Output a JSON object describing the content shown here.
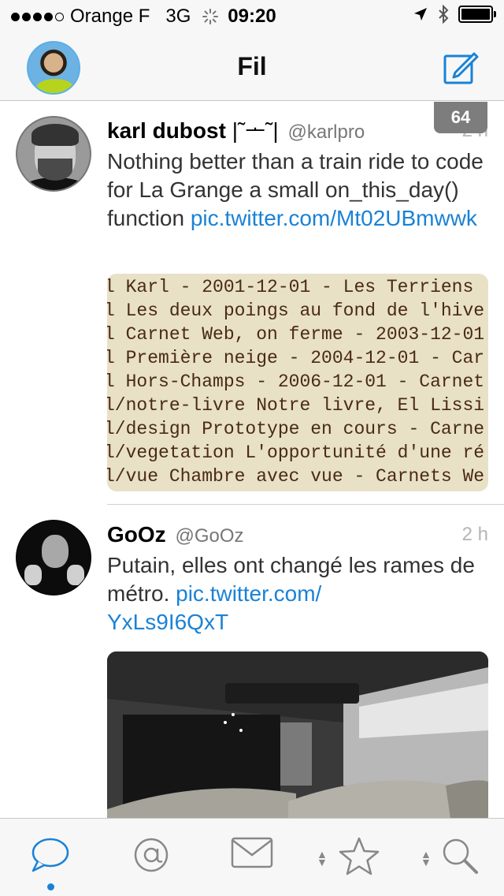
{
  "status_bar": {
    "carrier": "Orange F",
    "network": "3G",
    "time": "09:20"
  },
  "nav": {
    "title": "Fil"
  },
  "feed": {
    "new_count_badge": "64",
    "tweets": [
      {
        "name": "karl dubost",
        "name_glyph": "|˜ᅩ˜|",
        "handle": "@karlpro",
        "time": "2 h",
        "text": "Nothing better than a train ride to code for La Grange a small on_this_day() function",
        "link": "pic.twitter.com/Mt02UBmwwk",
        "image_lines": [
          "l Karl - 2001-12-01 - Les Terriens",
          "l Les deux poings au fond de l'hive",
          "l Carnet Web, on ferme - 2003-12-01",
          "l Première neige - 2004-12-01 - Car",
          "l Hors-Champs - 2006-12-01 - Carnet",
          "l/notre-livre Notre livre, El Lissi",
          "l/design Prototype en cours - Carne",
          "l/vegetation L'opportunité d'une ré",
          "l/vue Chambre avec vue - Carnets We"
        ]
      },
      {
        "name": "GoOz",
        "handle": "@GoOz",
        "time": "2 h",
        "text": "Putain, elles ont changé les rames de métro.",
        "link_part1": "pic.twitter.com/",
        "link_part2": "YxLs9I6QxT"
      }
    ]
  },
  "tab_bar": {
    "tabs": [
      "timeline-icon",
      "mentions-icon",
      "messages-icon",
      "favorites-icon",
      "search-icon"
    ],
    "active_index": 0
  },
  "colors": {
    "link": "#1a82d6",
    "accent": "#1a82d6",
    "bar_background": "#f7f7f7"
  }
}
